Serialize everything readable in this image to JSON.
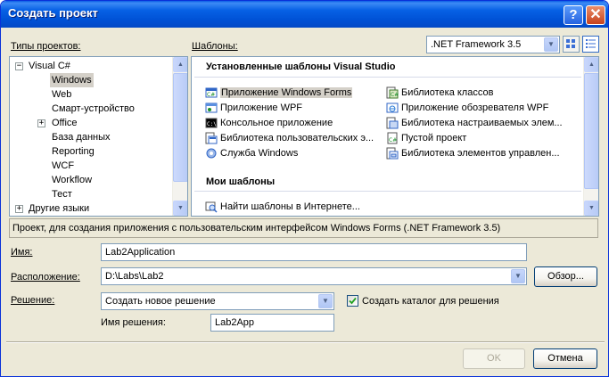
{
  "window": {
    "title": "Создать проект",
    "help": "?",
    "close": "✕"
  },
  "project_types": {
    "label": "Типы проектов:",
    "items": [
      {
        "label": "Visual C#",
        "expander": "−"
      },
      {
        "label": "Windows"
      },
      {
        "label": "Web"
      },
      {
        "label": "Смарт-устройство"
      },
      {
        "label": "Office",
        "expander": "+"
      },
      {
        "label": "База данных"
      },
      {
        "label": "Reporting"
      },
      {
        "label": "WCF"
      },
      {
        "label": "Workflow"
      },
      {
        "label": "Тест"
      },
      {
        "label": "Другие языки",
        "expander": "+"
      }
    ]
  },
  "templates": {
    "label": "Шаблоны:",
    "framework": ".NET Framework 3.5",
    "installed_header": "Установленные шаблоны Visual Studio",
    "installed": [
      "Приложение Windows Forms",
      "Библиотека классов",
      "Приложение WPF",
      "Приложение обозревателя WPF",
      "Консольное приложение",
      "Библиотека настраиваемых элем...",
      "Библиотека пользовательских э...",
      "Пустой проект",
      "Служба Windows",
      "Библиотека элементов управлен..."
    ],
    "my_header": "Мои шаблоны",
    "my": [
      "Найти шаблоны в Интернете..."
    ]
  },
  "description": "Проект, для создания приложения с пользовательским интерфейсом Windows Forms (.NET Framework 3.5)",
  "form": {
    "name_label": "Имя:",
    "name_value": "Lab2Application",
    "location_label": "Расположение:",
    "location_value": "D:\\Labs\\Lab2",
    "browse_button": "Обзор...",
    "solution_label": "Решение:",
    "solution_value": "Создать новое решение",
    "create_dir_label": "Создать каталог для решения",
    "create_dir_checked": true,
    "solution_name_label": "Имя решения:",
    "solution_name_value": "Lab2App"
  },
  "buttons": {
    "ok": "OK",
    "cancel": "Отмена"
  },
  "colors": {
    "title_bar": "#0058e6",
    "selection": "#d4d0c8",
    "border": "#7f9db9"
  }
}
